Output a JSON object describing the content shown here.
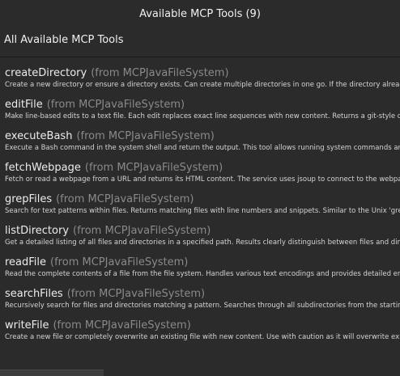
{
  "dialog": {
    "title": "Available MCP Tools (9)",
    "section_header": "All Available MCP Tools"
  },
  "tools": [
    {
      "name": "createDirectory",
      "source": "(from MCPJavaFileSystem)",
      "description": "Create a new directory or ensure a directory exists. Can create multiple directories in one go. If the directory already"
    },
    {
      "name": "editFile",
      "source": "(from MCPJavaFileSystem)",
      "description": "Make line-based edits to a text file. Each edit replaces exact line sequences with new content. Returns a git-style di"
    },
    {
      "name": "executeBash",
      "source": "(from MCPJavaFileSystem)",
      "description": "Execute a Bash command in the system shell and return the output. This tool allows running system commands and"
    },
    {
      "name": "fetchWebpage",
      "source": "(from MCPJavaFileSystem)",
      "description": "Fetch or read a webpage from a URL and returns its HTML content. The service uses jsoup to connect to the webpa"
    },
    {
      "name": "grepFiles",
      "source": "(from MCPJavaFileSystem)",
      "description": "Search for text patterns within files. Returns matching files with line numbers and snippets. Similar to the Unix 'grep'"
    },
    {
      "name": "listDirectory",
      "source": "(from MCPJavaFileSystem)",
      "description": "Get a detailed listing of all files and directories in a specified path. Results clearly distinguish between files and direc"
    },
    {
      "name": "readFile",
      "source": "(from MCPJavaFileSystem)",
      "description": "Read the complete contents of a file from the file system. Handles various text encodings and provides detailed erro"
    },
    {
      "name": "searchFiles",
      "source": "(from MCPJavaFileSystem)",
      "description": "Recursively search for files and directories matching a pattern. Searches through all subdirectories from the starting"
    },
    {
      "name": "writeFile",
      "source": "(from MCPJavaFileSystem)",
      "description": "Create a new file or completely overwrite an existing file with new content. Use with caution as it will overwrite existin"
    }
  ]
}
